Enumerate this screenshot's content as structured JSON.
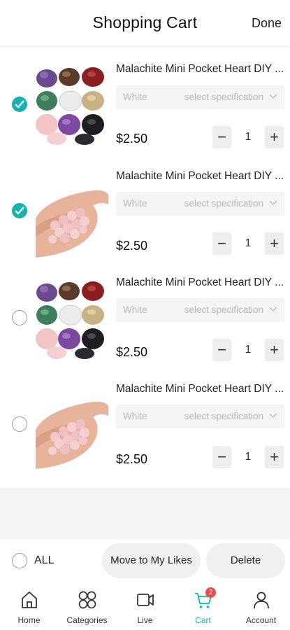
{
  "header": {
    "title": "Shopping Cart",
    "done_label": "Done"
  },
  "items": [
    {
      "name": "Malachite Mini Pocket Heart DIY ...",
      "color": "White",
      "spec_placeholder": "select specification",
      "price": "$2.50",
      "quantity": "1",
      "selected": true,
      "image": "assorted-crystal-stones"
    },
    {
      "name": "Malachite Mini Pocket Heart DIY ...",
      "color": "White",
      "spec_placeholder": "select specification",
      "price": "$2.50",
      "quantity": "1",
      "selected": true,
      "image": "rose-quartz-hearts-in-hand"
    },
    {
      "name": "Malachite Mini Pocket Heart DIY ...",
      "color": "White",
      "spec_placeholder": "select specification",
      "price": "$2.50",
      "quantity": "1",
      "selected": false,
      "image": "assorted-crystal-stones"
    },
    {
      "name": "Malachite Mini Pocket Heart DIY ...",
      "color": "White",
      "spec_placeholder": "select specification",
      "price": "$2.50",
      "quantity": "1",
      "selected": false,
      "image": "rose-quartz-hearts-in-hand"
    }
  ],
  "footer": {
    "all_label": "ALL",
    "move_label": "Move to My Likes",
    "delete_label": "Delete"
  },
  "tabs": [
    {
      "label": "Home",
      "icon": "home-icon"
    },
    {
      "label": "Categories",
      "icon": "categories-icon"
    },
    {
      "label": "Live",
      "icon": "video-icon"
    },
    {
      "label": "Cart",
      "icon": "cart-icon",
      "badge": "2",
      "active": true
    },
    {
      "label": "Account",
      "icon": "account-icon"
    }
  ],
  "colors": {
    "accent": "#14b3b0",
    "badge": "#f04a4a",
    "stepper_bg": "#eeeeee",
    "spec_bg": "#f5f5f5"
  }
}
